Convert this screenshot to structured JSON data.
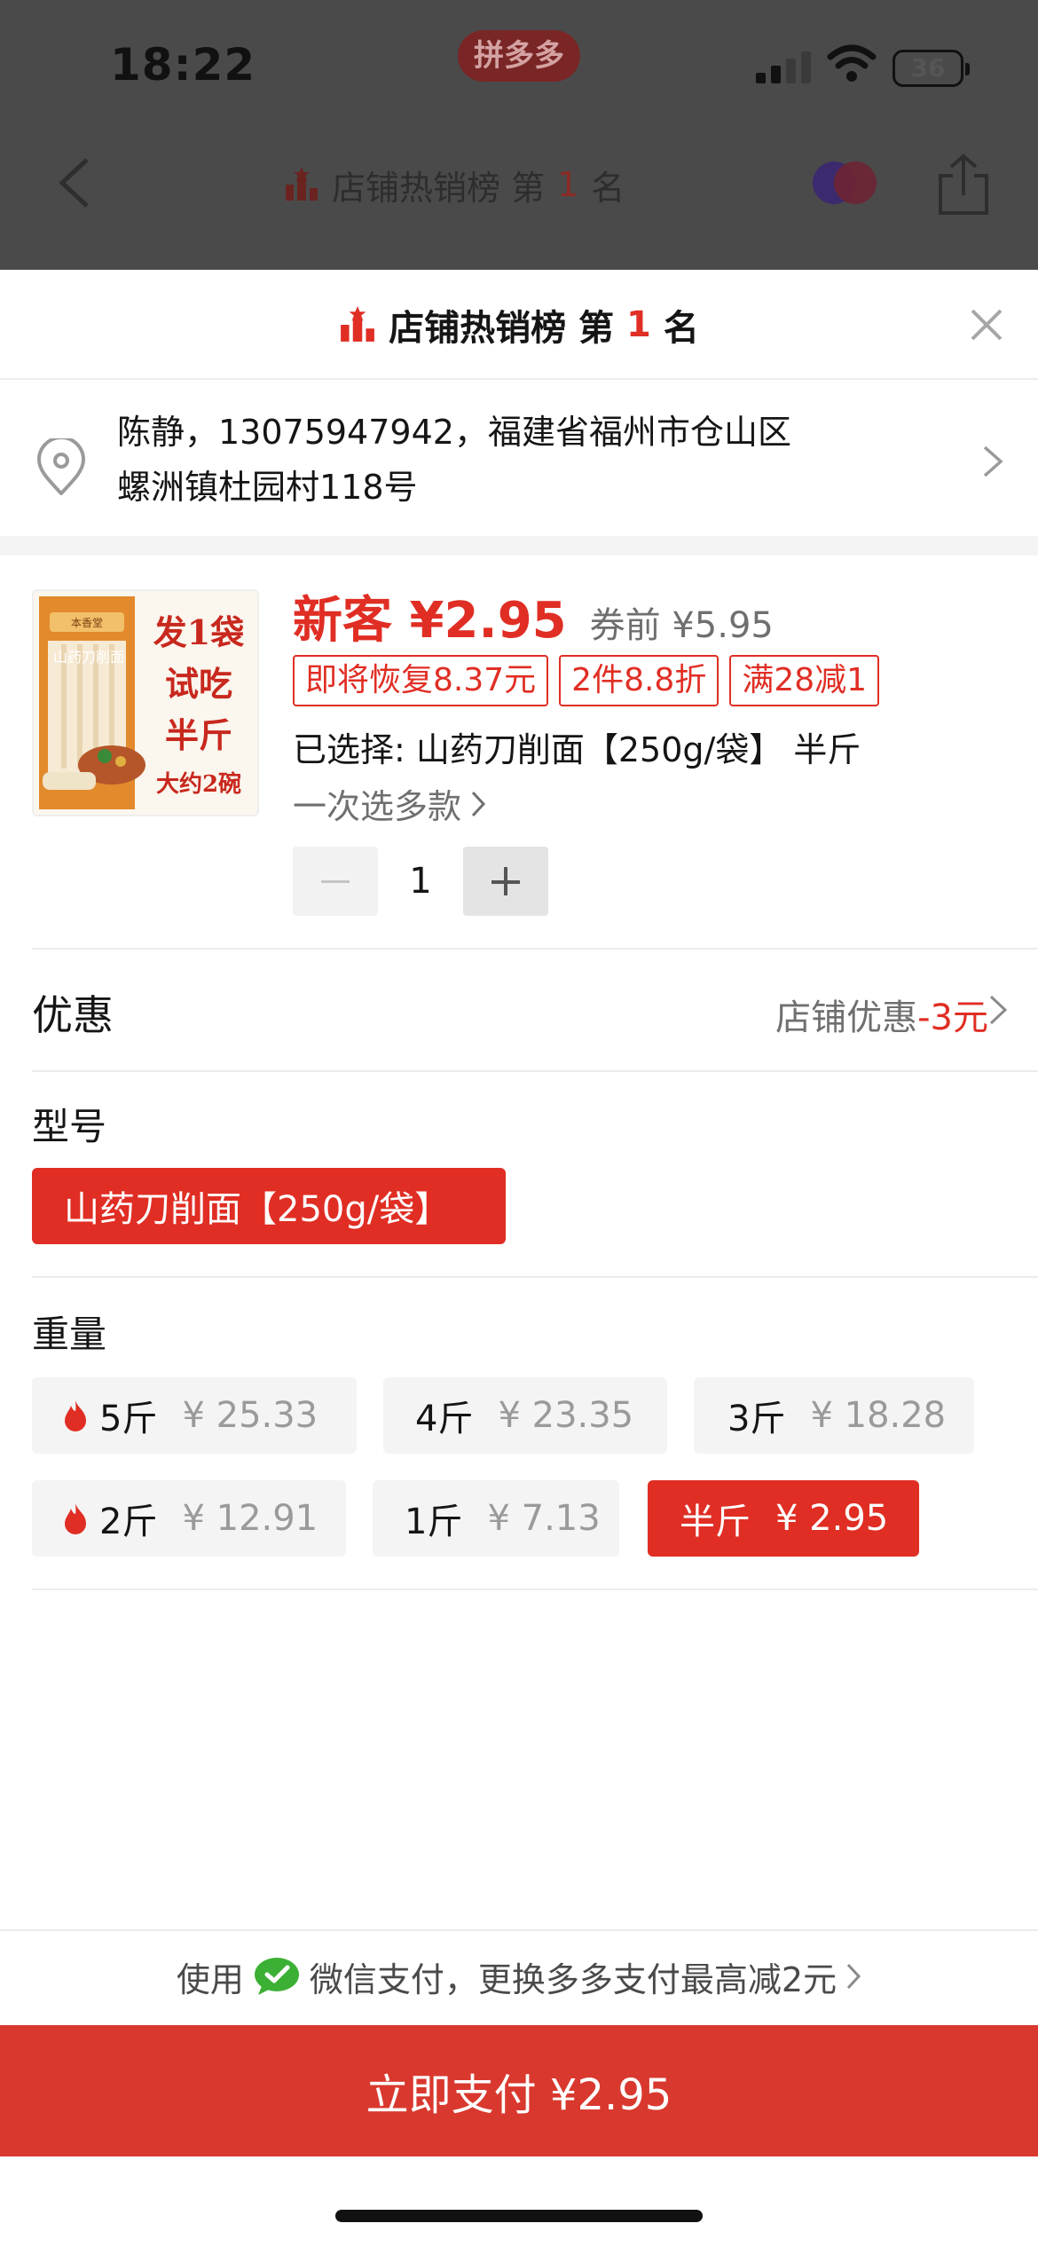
{
  "status_bar": {
    "time": "18:22",
    "battery": "36"
  },
  "background_page": {
    "app_badge": "拼多多",
    "nav_title_prefix": "店铺热销榜 第",
    "nav_title_rank": "1",
    "nav_title_suffix": "名"
  },
  "sheet": {
    "title_prefix": "店铺热销榜 第",
    "title_rank": "1",
    "title_suffix": "名",
    "address_line1": "陈静，13075947942，福建省福州市仓山区",
    "address_line2": "螺洲镇杜园村118号"
  },
  "product": {
    "image_text": {
      "brand": "本香堂",
      "side": "山药刀削面",
      "line1": "发1袋",
      "line2": "试吃",
      "line3": "半斤",
      "line4": "大约2碗"
    },
    "new_price": "新客 ¥2.95",
    "old_price": "券前 ¥5.95",
    "tags": [
      "即将恢复8.37元",
      "2件8.8折",
      "满28减1"
    ],
    "selected": "已选择: 山药刀削面【250g/袋】 半斤",
    "multi_select": "一次选多款",
    "quantity": "1"
  },
  "promo": {
    "label": "优惠",
    "value_prefix": "店铺优惠",
    "value_red": "-3元"
  },
  "model": {
    "label": "型号",
    "option": "山药刀削面【250g/袋】"
  },
  "weight": {
    "label": "重量",
    "options": [
      {
        "name": "5斤",
        "price": "¥ 25.33",
        "hot": true,
        "selected": false
      },
      {
        "name": "4斤",
        "price": "¥ 23.35",
        "hot": false,
        "selected": false
      },
      {
        "name": "3斤",
        "price": "¥ 18.28",
        "hot": false,
        "selected": false
      },
      {
        "name": "2斤",
        "price": "¥ 12.91",
        "hot": true,
        "selected": false
      },
      {
        "name": "1斤",
        "price": "¥ 7.13",
        "hot": false,
        "selected": false
      },
      {
        "name": "半斤",
        "price": "¥ 2.95",
        "hot": false,
        "selected": true
      }
    ]
  },
  "payment": {
    "tip_prefix": "使用",
    "tip_suffix": "微信支付，更换多多支付最高减2元",
    "button": "立即支付 ¥2.95"
  },
  "colors": {
    "accent": "#e02e24",
    "button": "#d9382e",
    "wechat": "#3cb034"
  }
}
